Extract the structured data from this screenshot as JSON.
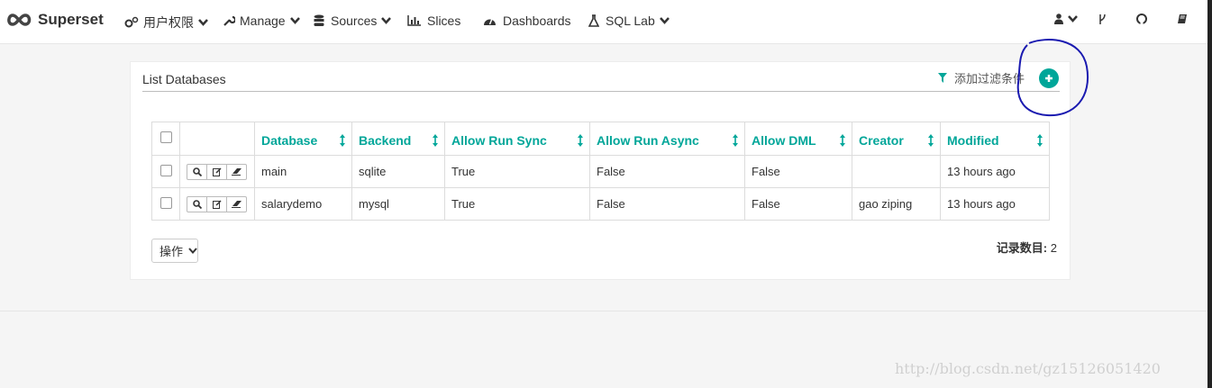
{
  "navbar": {
    "brand": "Superset",
    "items": [
      {
        "label": "用户权限",
        "icon": "gears-icon"
      },
      {
        "label": "Manage",
        "icon": "wrench-icon"
      },
      {
        "label": "Sources",
        "icon": "database-icon"
      },
      {
        "label": "Slices",
        "icon": "bar-chart-icon"
      },
      {
        "label": "Dashboards",
        "icon": "dashboard-icon"
      },
      {
        "label": "SQL Lab",
        "icon": "flask-icon"
      }
    ],
    "right_icons": [
      "user-icon",
      "git-branch-icon",
      "github-icon",
      "book-icon"
    ]
  },
  "panel": {
    "title": "List Databases",
    "filter_label": "添加过滤条件"
  },
  "table": {
    "columns": [
      "Database",
      "Backend",
      "Allow Run Sync",
      "Allow Run Async",
      "Allow DML",
      "Creator",
      "Modified"
    ],
    "rows": [
      {
        "database": "main",
        "backend": "sqlite",
        "sync": "True",
        "async": "False",
        "dml": "False",
        "creator": "",
        "modified": "13 hours ago"
      },
      {
        "database": "salarydemo",
        "backend": "mysql",
        "sync": "True",
        "async": "False",
        "dml": "False",
        "creator": "gao ziping",
        "modified": "13 hours ago"
      }
    ]
  },
  "footer": {
    "actions_label": "操作",
    "count_label": "记录数目:",
    "count_value": "2"
  },
  "watermark": "http://blog.csdn.net/gz15126051420",
  "colors": {
    "accent": "#00a699",
    "annotation": "#1a1ab0"
  }
}
